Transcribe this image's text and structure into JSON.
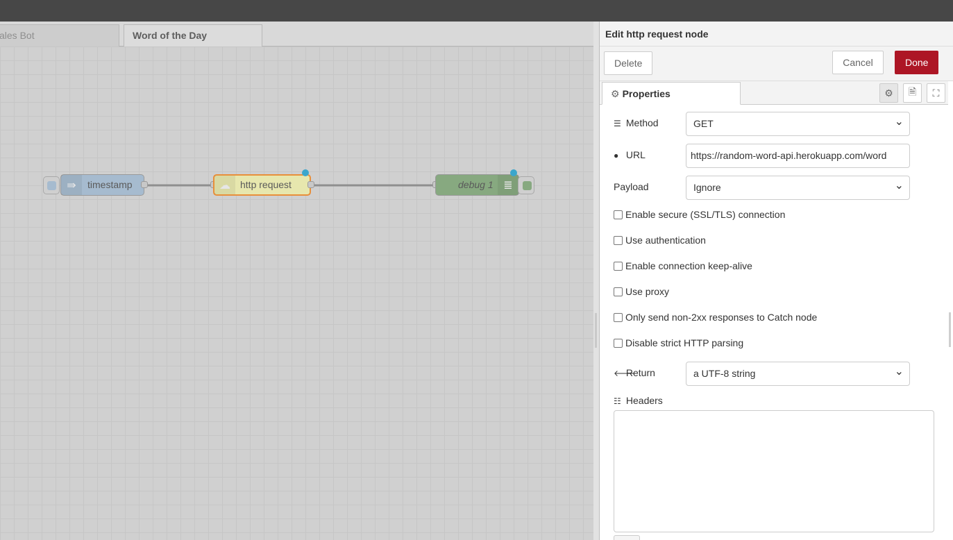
{
  "workspace": {
    "tabs": [
      {
        "label": "ales Bot"
      },
      {
        "label": "Word of the Day"
      }
    ],
    "nodes": {
      "inject": {
        "label": "timestamp",
        "color": "#a6bbcf"
      },
      "http": {
        "label": "http request",
        "color": "#e7e7ae"
      },
      "debug": {
        "label": "debug 1",
        "color": "#87a980"
      }
    }
  },
  "panel": {
    "title": "Edit http request node",
    "delete_label": "Delete",
    "cancel_label": "Cancel",
    "done_label": "Done",
    "tab_label": "Properties",
    "method": {
      "label": "Method",
      "value": "GET"
    },
    "url": {
      "label": "URL",
      "value": "https://random-word-api.herokuapp.com/word"
    },
    "payload": {
      "label": "Payload",
      "value": "Ignore"
    },
    "checkboxes": {
      "ssl": "Enable secure (SSL/TLS) connection",
      "auth": "Use authentication",
      "keepalive": "Enable connection keep-alive",
      "proxy": "Use proxy",
      "non2xx": "Only send non-2xx responses to Catch node",
      "strict": "Disable strict HTTP parsing"
    },
    "return": {
      "label": "Return",
      "value": "a UTF-8 string"
    },
    "headers_label": "Headers"
  },
  "colors": {
    "done": "#ad1625",
    "port_dot": "#3aa6cc"
  }
}
